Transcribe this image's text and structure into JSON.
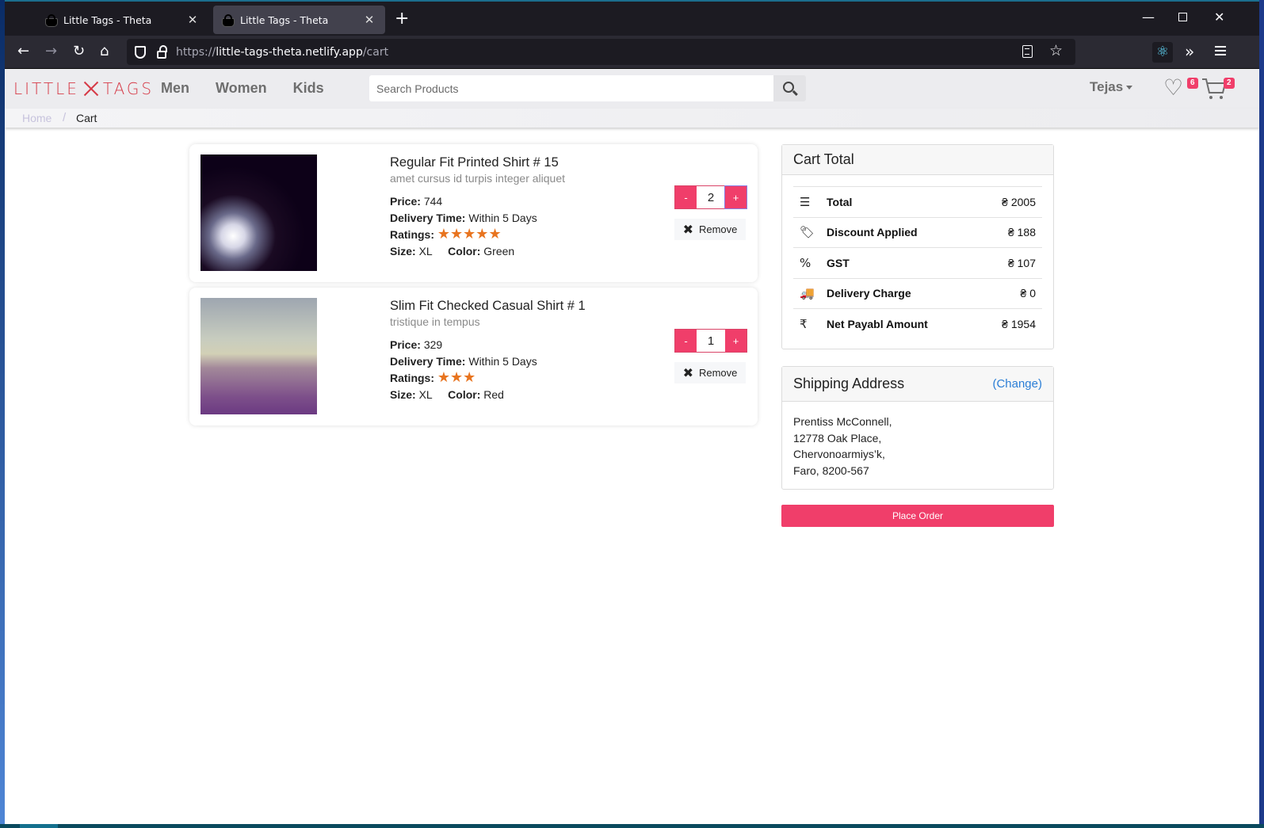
{
  "browser": {
    "tabs": [
      {
        "title": "Little Tags - Theta",
        "active": false
      },
      {
        "title": "Little Tags - Theta",
        "active": true
      }
    ],
    "url_prefix": "https://",
    "url_host": "little-tags-theta.netlify.app",
    "url_path": "/cart",
    "icons": {
      "back": "←",
      "forward": "→",
      "reload": "↻",
      "home": "⌂",
      "star": "☆",
      "react_devtools": "⚛",
      "overflow": "»",
      "new_tab": "+",
      "close_tab": "✕",
      "minimize": "—",
      "close_window": "✕"
    }
  },
  "site": {
    "logo_left": "LITTLE",
    "logo_right": "TAGS",
    "nav": [
      "Men",
      "Women",
      "Kids"
    ],
    "search_placeholder": "Search Products",
    "user_name": "Tejas",
    "wishlist_count": "6",
    "cart_count": "2",
    "heart_icon": "♡"
  },
  "breadcrumb": {
    "home": "Home",
    "separator": "/",
    "current": "Cart"
  },
  "cart_items": [
    {
      "name": "Regular Fit Printed Shirt # 15",
      "description": "amet cursus id turpis integer aliquet",
      "price_label": "Price:",
      "price": "744",
      "delivery_label": "Delivery Time:",
      "delivery": "Within 5 Days",
      "ratings_label": "Ratings:",
      "rating": 5,
      "stars": "★★★★★",
      "size_label": "Size:",
      "size": "XL",
      "color_label": "Color:",
      "color": "Green",
      "quantity": "2",
      "minus": "-",
      "plus": "+",
      "remove_label": "Remove",
      "remove_icon": "✖"
    },
    {
      "name": "Slim Fit Checked Casual Shirt # 1",
      "description": "tristique in tempus",
      "price_label": "Price:",
      "price": "329",
      "delivery_label": "Delivery Time:",
      "delivery": "Within 5 Days",
      "ratings_label": "Ratings:",
      "rating": 3,
      "stars": "★★★",
      "size_label": "Size:",
      "size": "XL",
      "color_label": "Color:",
      "color": "Red",
      "quantity": "1",
      "minus": "-",
      "plus": "+",
      "remove_label": "Remove",
      "remove_icon": "✖"
    }
  ],
  "cart_total": {
    "title": "Cart Total",
    "rows": [
      {
        "icon": "☰",
        "icon_name": "receipt-list-icon",
        "label": "Total",
        "value": "₴ 2005"
      },
      {
        "icon": "🏷",
        "icon_name": "tag-icon",
        "label": "Discount Applied",
        "value": "₴ 188"
      },
      {
        "icon": "%",
        "icon_name": "tax-receipt-icon",
        "label": "GST",
        "value": "₴ 107"
      },
      {
        "icon": "🚚",
        "icon_name": "truck-icon",
        "label": "Delivery Charge",
        "value": "₴ 0"
      },
      {
        "icon": "₹",
        "icon_name": "rupee-icon",
        "label": "Net Payabl Amount",
        "value": "₴ 1954"
      }
    ]
  },
  "shipping": {
    "title": "Shipping Address",
    "change_label": "(Change)",
    "lines": [
      "Prentiss McConnell,",
      "12778 Oak Place,",
      "Chervonoarmiys’k,",
      "Faro, 8200-567"
    ]
  },
  "place_order_label": "Place Order",
  "colors": {
    "accent": "#f03e6a",
    "brand": "#d63a47",
    "star": "#e8741f",
    "link": "#2b7ed6"
  }
}
